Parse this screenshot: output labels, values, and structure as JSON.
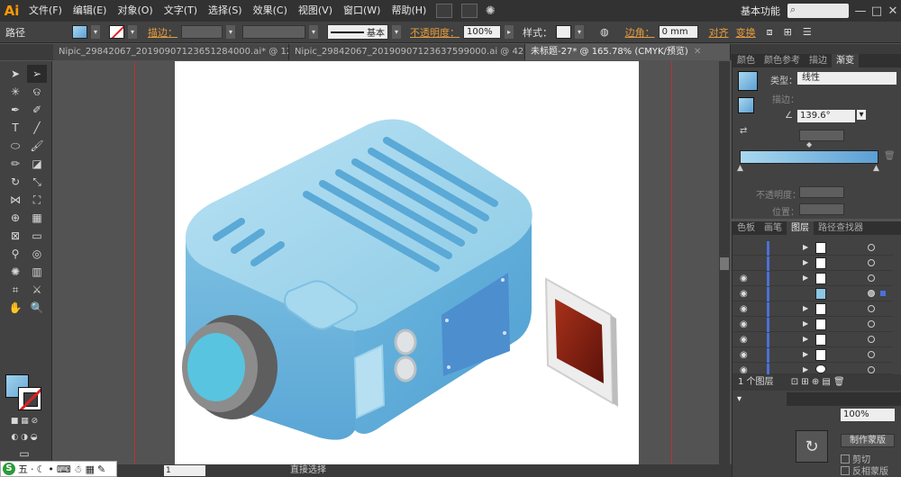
{
  "menubar": {
    "logo": "Ai",
    "items": [
      "文件(F)",
      "编辑(E)",
      "对象(O)",
      "文字(T)",
      "选择(S)",
      "效果(C)",
      "视图(V)",
      "窗口(W)",
      "帮助(H)"
    ],
    "workspace": "基本功能",
    "win_controls": [
      "—",
      "□",
      "✕"
    ]
  },
  "controlbar": {
    "object_type": "路径",
    "stroke_label": "描边：",
    "stroke_style": "基本",
    "opacity_label": "不透明度：",
    "opacity_value": "100%",
    "style_label": "样式：",
    "corner_label": "边角：",
    "corner_value": "0 mm",
    "align_label": "对齐",
    "transform_label": "变换"
  },
  "tabs": [
    {
      "title": "Nipic_29842067_20190907123651284000.ai* @ 12...",
      "close": "✕"
    },
    {
      "title": "Nipic_29842067_20190907123637599000.ai @ 42...",
      "close": "✕"
    },
    {
      "title": "未标题-27* @ 165.78% (CMYK/预览)",
      "close": "✕"
    }
  ],
  "gradient_panel": {
    "tabs": [
      "颜色",
      "颜色参考",
      "描边",
      "渐变"
    ],
    "type_label": "类型：",
    "type_value": "线性",
    "stroke_label": "描边：",
    "angle_value": "139.6°",
    "opacity_label": "不透明度：",
    "location_label": "位置："
  },
  "layers_panel": {
    "tabs": [
      "色板",
      "画笔",
      "图层",
      "路径查找器"
    ],
    "footer": "1 个图层"
  },
  "transparency_panel": {
    "percent": "100%",
    "make_mask": "制作蒙版",
    "clip": "剪切",
    "invert": "反相蒙版"
  },
  "statusbar": {
    "zoom": "165.78%",
    "page": "1",
    "tool": "直接选择"
  },
  "ime": {
    "logo": "S",
    "mode": "五"
  },
  "colors": {
    "gradient_start": "#a9d8ef",
    "gradient_end": "#5b9fd4",
    "projector_body": "#8cc7e4",
    "lens_gray": "#666666",
    "slide_red": "#7a1a10"
  }
}
